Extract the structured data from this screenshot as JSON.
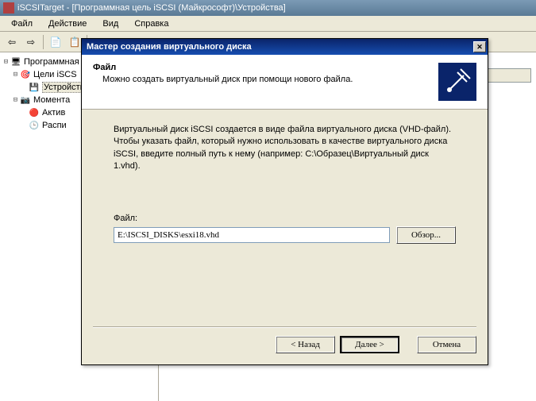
{
  "main": {
    "title": "iSCSITarget - [Программная цель iSCSI (Майкрософт)\\Устройства]"
  },
  "menu": {
    "file": "Файл",
    "action": "Действие",
    "view": "Вид",
    "help": "Справка"
  },
  "tree": {
    "root": "Программная",
    "targets": "Цели iSCS",
    "devices": "Устройств",
    "snapshots": "Момента",
    "active": "Актив",
    "schedule": "Распи"
  },
  "dialog": {
    "title": "Мастер создания виртуального диска",
    "header_title": "Файл",
    "header_sub": "Можно создать виртуальный диск при помощи нового файла.",
    "body_text": "Виртуальный диск iSCSI создается в виде файла виртуального диска (VHD-файл). Чтобы указать файл, который нужно использовать в качестве виртуального диска iSCSI, введите полный путь к нему (например: C:\\Образец\\Виртуальный диск 1.vhd).",
    "field_label": "Файл:",
    "field_value": "E:\\ISCSI_DISKS\\esxi18.vhd",
    "browse": "Обзор...",
    "back": "< Назад",
    "next": "Далее >",
    "cancel": "Отмена"
  }
}
